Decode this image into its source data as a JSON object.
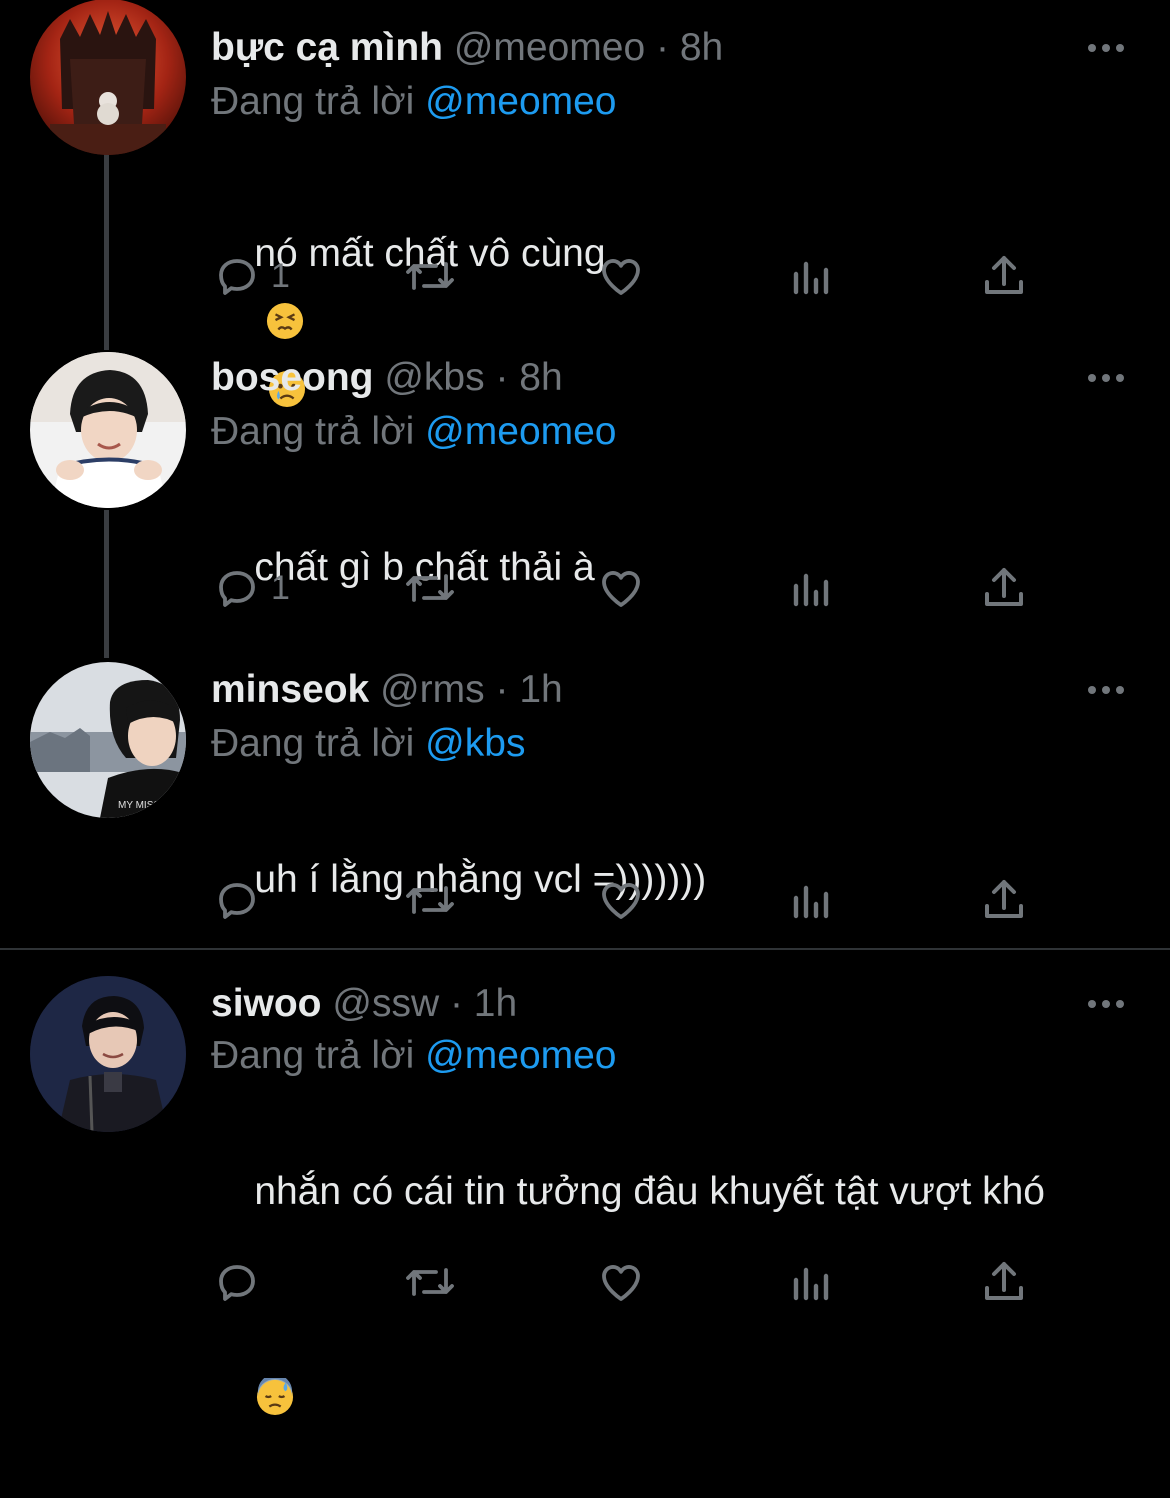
{
  "reply_prefix": "Đang trả lời ",
  "colors": {
    "background": "#000000",
    "text": "#e7e9ea",
    "muted": "#71767b",
    "mention": "#1d9bf0"
  },
  "tweets": [
    {
      "display_name": "bực cạ mình",
      "handle": "@meomeo",
      "sep": " · ",
      "time": "8h",
      "replying_to": "@meomeo",
      "text": "nó mất chất vô cùng",
      "emojis": [
        "persevering-face-emoji",
        "crying-face-emoji"
      ],
      "reply_count": "1",
      "icons": [
        "reply-icon",
        "retweet-icon",
        "like-icon",
        "views-icon",
        "share-icon"
      ]
    },
    {
      "display_name": "boseong",
      "handle": "@kbs",
      "sep": " · ",
      "time": "8h",
      "replying_to": "@meomeo",
      "text": "chất gì b chất thải à",
      "reply_count": "1"
    },
    {
      "display_name": "minseok",
      "handle": "@rms",
      "sep": " · ",
      "time": "1h",
      "replying_to": "@kbs",
      "text": "uh í lằng nhằng vcl =)))))))",
      "reply_count": ""
    },
    {
      "display_name": "siwoo",
      "handle": "@ssw",
      "sep": " · ",
      "time": "1h",
      "replying_to": "@meomeo",
      "text": "nhắn có cái tin tưởng đâu khuyết tật vượt khó",
      "emojis": [
        "downcast-sweat-face-emoji"
      ],
      "reply_count": ""
    }
  ]
}
